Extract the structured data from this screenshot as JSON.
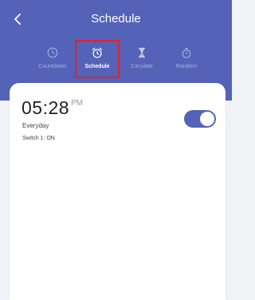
{
  "header": {
    "title": "Schedule",
    "back_icon": "chevron-left-icon",
    "background": "#5462b7"
  },
  "tabs": [
    {
      "label": "Countdown",
      "icon": "clock-icon",
      "active": false
    },
    {
      "label": "Schedule",
      "icon": "alarm-clock-icon",
      "active": true
    },
    {
      "label": "Circulate",
      "icon": "hourglass-icon",
      "active": false
    },
    {
      "label": "Random",
      "icon": "stopwatch-icon",
      "active": false
    }
  ],
  "schedule_item": {
    "time": "05:28",
    "ampm": "PM",
    "repeat": "Everyday",
    "action": "Switch 1: ON",
    "enabled": true,
    "toggle_color": "#5462b7"
  }
}
